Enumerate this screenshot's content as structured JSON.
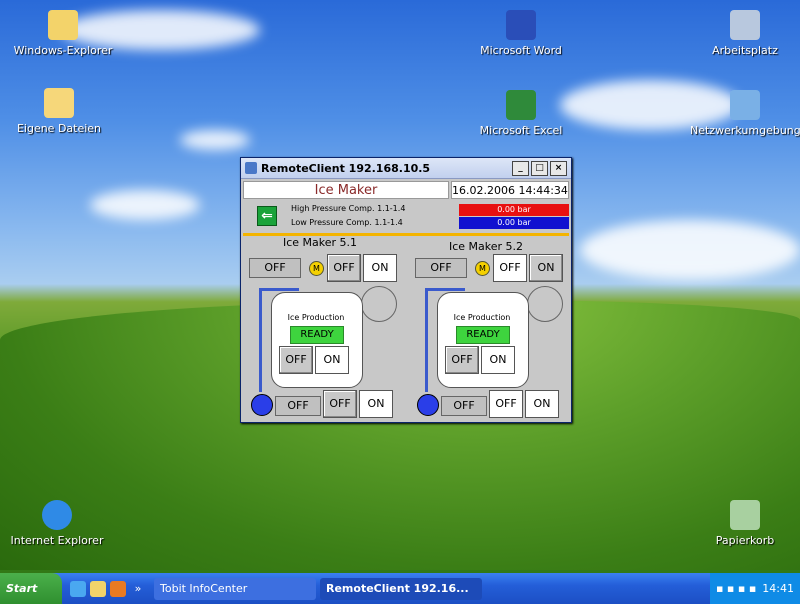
{
  "desktop": {
    "icons": [
      {
        "label": "Windows-Explorer"
      },
      {
        "label": "Eigene Dateien"
      },
      {
        "label": "Microsoft Word"
      },
      {
        "label": "Microsoft Excel"
      },
      {
        "label": "Arbeitsplatz"
      },
      {
        "label": "Netzwerkumgebung"
      },
      {
        "label": "Internet Explorer"
      },
      {
        "label": "Papierkorb"
      }
    ]
  },
  "window": {
    "title": "RemoteClient 192.168.10.5",
    "controls": {
      "min": "_",
      "max": "□",
      "close": "×"
    },
    "header": {
      "name": "Ice Maker",
      "datetime": "16.02.2006 14:44:34"
    },
    "pressure": {
      "high_label": "High Pressure Comp. 1.1-1.4",
      "low_label": "Low Pressure Comp. 1.1-1.4",
      "high_value": "0.00 bar",
      "low_value": "0.00 bar",
      "high_color": "#e81010",
      "low_color": "#1010d0"
    },
    "units": [
      {
        "title": "Ice Maker  5.1",
        "top_status": "OFF",
        "motor": "M",
        "top_off": "OFF",
        "top_on": "ON",
        "ip_label": "Ice Production",
        "ready": "READY",
        "mid_off": "OFF",
        "mid_on": "ON",
        "bottom_status": "OFF",
        "bottom_off": "OFF",
        "bottom_on": "ON"
      },
      {
        "title": "Ice Maker  5.2",
        "top_status": "OFF",
        "motor": "M",
        "top_off": "OFF",
        "top_on": "ON",
        "ip_label": "Ice Production",
        "ready": "READY",
        "mid_off": "OFF",
        "mid_on": "ON",
        "bottom_status": "OFF",
        "bottom_off": "OFF",
        "bottom_on": "ON"
      }
    ]
  },
  "taskbar": {
    "start": "Start",
    "tasks": [
      {
        "label": "Tobit InfoCenter"
      },
      {
        "label": "RemoteClient 192.16..."
      }
    ],
    "clock": "14:41",
    "overflow": "»"
  }
}
